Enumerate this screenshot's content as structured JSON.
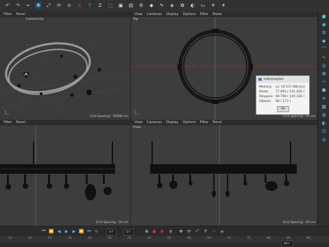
{
  "toolbar": {
    "icons": [
      {
        "name": "undo-icon",
        "glyph": "↶"
      },
      {
        "name": "redo-icon",
        "glyph": "↷"
      },
      {
        "name": "live-select-icon",
        "glyph": "⌖"
      },
      {
        "name": "move-icon",
        "glyph": "✥"
      },
      {
        "name": "scale-icon",
        "glyph": "⤢"
      },
      {
        "name": "rotate-icon",
        "glyph": "⟳"
      },
      {
        "name": "recent-tools-icon",
        "glyph": "⊙"
      },
      {
        "name": "axis-x-icon",
        "glyph": "X"
      },
      {
        "name": "axis-y-icon",
        "glyph": "Y"
      },
      {
        "name": "axis-z-icon",
        "glyph": "Z"
      },
      {
        "name": "coordinate-system-icon",
        "glyph": "⬚"
      },
      {
        "name": "render-view-icon",
        "glyph": "▣"
      },
      {
        "name": "render-picture-viewer-icon",
        "glyph": "▤"
      },
      {
        "name": "render-settings-icon",
        "glyph": "⚙"
      },
      {
        "name": "cube-icon",
        "glyph": "◆"
      },
      {
        "name": "pen-icon",
        "glyph": "✎"
      },
      {
        "name": "subdivision-icon",
        "glyph": "◈"
      },
      {
        "name": "array-icon",
        "glyph": "✿"
      },
      {
        "name": "deformer-icon",
        "glyph": "◐"
      },
      {
        "name": "floor-icon",
        "glyph": "▭"
      },
      {
        "name": "camera-icon",
        "glyph": "✈"
      },
      {
        "name": "light-icon",
        "glyph": "✦"
      }
    ]
  },
  "viewports": {
    "perspective": {
      "menu": [
        "Filter",
        "Panel"
      ],
      "title": "Camera",
      "title_badge": "On",
      "grid_spacing": "Grid Spacing : 50000 cm"
    },
    "top": {
      "menu": [
        "View",
        "Cameras",
        "Display",
        "Options",
        "Filter",
        "Panel"
      ],
      "title": "Top",
      "grid_spacing": "Grid Spacing : 50 cm"
    },
    "right": {
      "menu": [
        "Filter",
        "Panel"
      ],
      "title": "",
      "grid_spacing": "Grid Spacing : 50 cm"
    },
    "front": {
      "menu": [
        "View",
        "Cameras",
        "Display",
        "Options",
        "Filter",
        "Panel"
      ],
      "title": "Front",
      "grid_spacing": "Grid Spacing : 50 cm"
    }
  },
  "info_dialog": {
    "title": "Information",
    "rows": [
      {
        "label": "Memory",
        "value": "ca. 10 127 KB(s)(s)"
      },
      {
        "label": "Points",
        "value": "77 691 ( 141 420 )"
      },
      {
        "label": "Polygons",
        "value": "69 700 ( 145 326 )"
      },
      {
        "label": "Objects",
        "value": "98 ( 173 )"
      }
    ],
    "ok_label": "OK"
  },
  "right_strip": {
    "icons": [
      "dot-icon",
      "sphere-icon",
      "settings-icon",
      "cube-blue-icon",
      "bend-icon",
      "spline-icon",
      "tube-icon",
      "cloner-icon",
      "sweep-icon",
      "tag-icon",
      "camera-tool-icon",
      "grid-icon",
      "globe-icon",
      "material-icon",
      "python-icon",
      "target-icon"
    ]
  },
  "timeline": {
    "current_frame": "0 F",
    "end_frame": "90 F",
    "start_frame": "0 F",
    "ruler_ticks": [
      "15",
      "20",
      "25",
      "30",
      "35",
      "40",
      "45",
      "50",
      "55",
      "60",
      "65",
      "70",
      "75",
      "80",
      "85",
      "90"
    ]
  }
}
